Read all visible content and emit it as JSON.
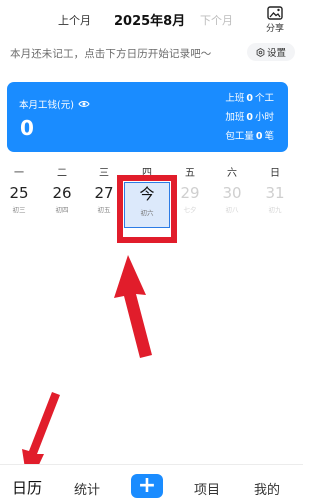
{
  "header": {
    "prev_label": "上个月",
    "current_month": "2025年8月",
    "next_label": "下个月",
    "share_label": "分享"
  },
  "notice": "本月还未记工，点击下方日历开始记录吧～",
  "settings_label": "设置",
  "summary": {
    "label": "本月工钱(元)",
    "amount": "0",
    "work": {
      "prefix": "上班",
      "value": "0",
      "unit": "个工"
    },
    "overtime": {
      "prefix": "加班",
      "value": "0",
      "unit": "小时"
    },
    "piecework": {
      "prefix": "包工量",
      "value": "0",
      "unit": "笔"
    }
  },
  "weekdays": [
    "一",
    "二",
    "三",
    "四",
    "五",
    "六",
    "日"
  ],
  "days": [
    {
      "num": "25",
      "lunar": "初三"
    },
    {
      "num": "26",
      "lunar": "初四"
    },
    {
      "num": "27",
      "lunar": "初五"
    },
    {
      "num": "今",
      "lunar": "初六"
    },
    {
      "num": "29",
      "lunar": "七夕"
    },
    {
      "num": "30",
      "lunar": "初八"
    },
    {
      "num": "31",
      "lunar": "初九"
    }
  ],
  "tabs": {
    "calendar": "日历",
    "stats": "统计",
    "add": "+",
    "project": "项目",
    "mine": "我的"
  },
  "colors": {
    "primary": "#1a8cff",
    "annotation": "#e11d2b"
  }
}
